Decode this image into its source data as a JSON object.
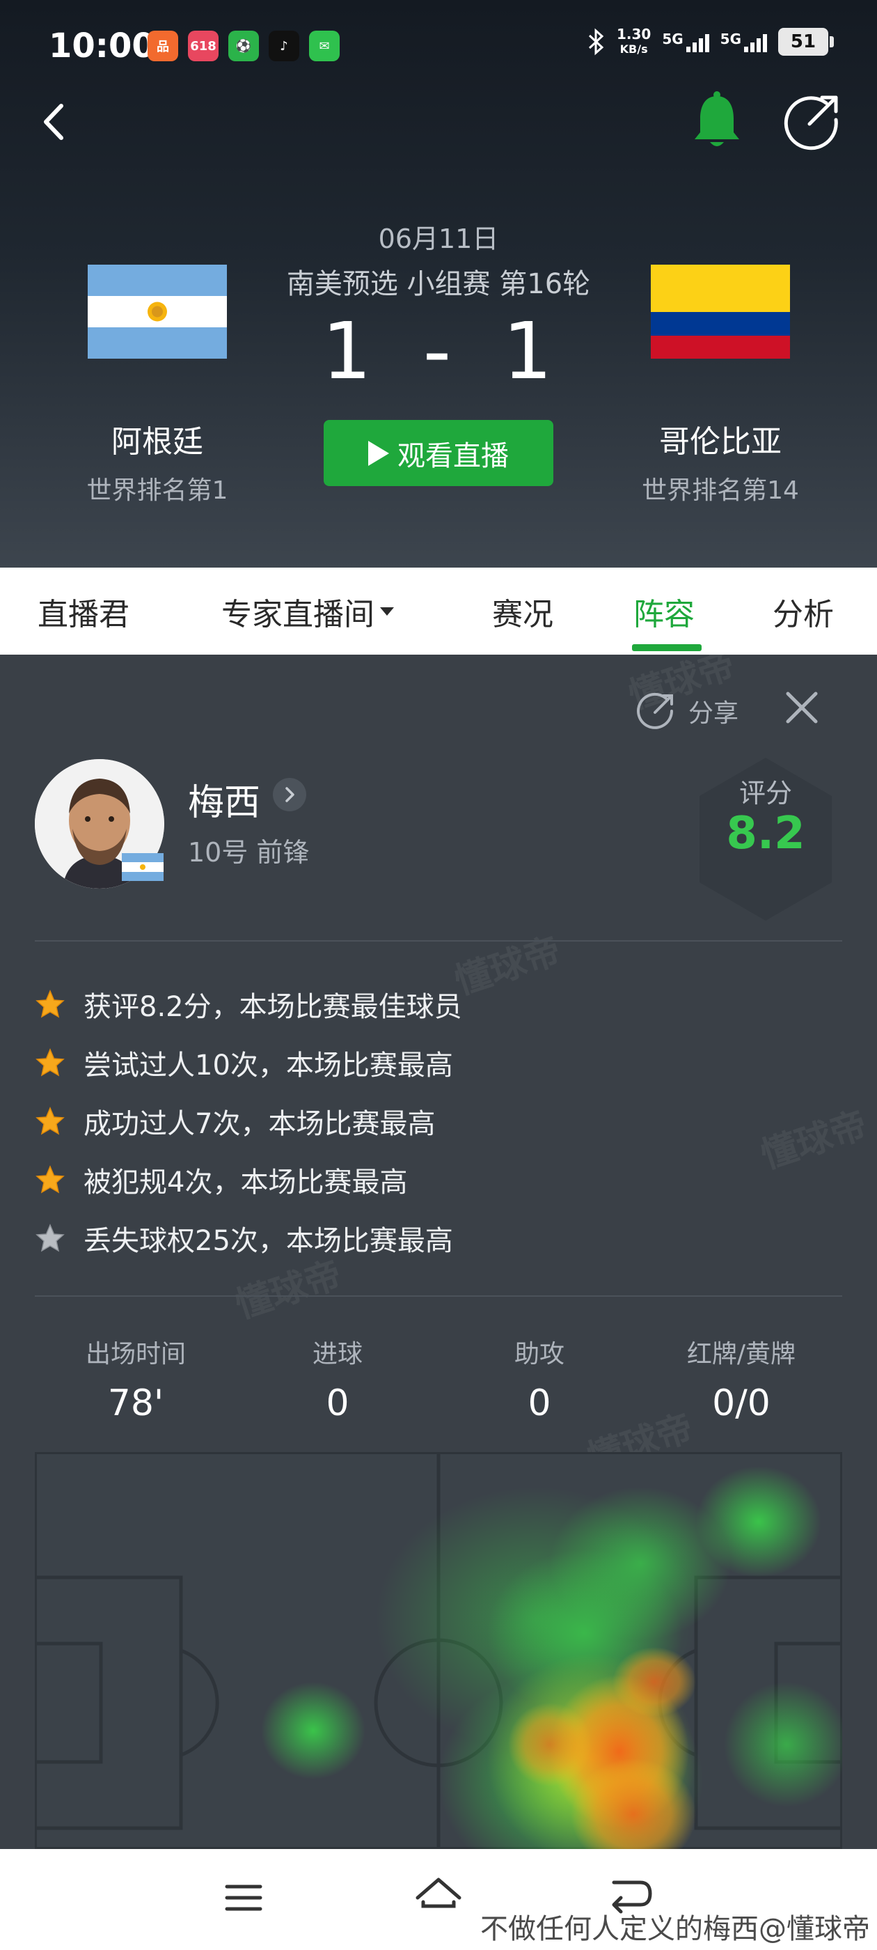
{
  "status_bar": {
    "time": "10:00",
    "net_speed_value": "1.30",
    "net_speed_unit": "KB/s",
    "sim1": "5G",
    "sim2": "5G",
    "battery": "51",
    "apps": [
      {
        "name": "shopping-app-icon",
        "color": "#f26a2e",
        "glyph": "品"
      },
      {
        "name": "618-app-icon",
        "color": "#e8475f",
        "glyph": "618"
      },
      {
        "name": "green-app-icon",
        "color": "#2bb34a",
        "glyph": "⚽"
      },
      {
        "name": "tiktok-icon",
        "color": "#111111",
        "glyph": "♪"
      },
      {
        "name": "wechat-icon",
        "color": "#2fc14e",
        "glyph": "✉"
      }
    ]
  },
  "match": {
    "date": "06月11日",
    "competition": "南美预选 小组赛 第16轮",
    "home_score": "1",
    "separator": "-",
    "away_score": "1",
    "home": {
      "name": "阿根廷",
      "rank": "世界排名第1"
    },
    "away": {
      "name": "哥伦比亚",
      "rank": "世界排名第14"
    },
    "watch_label": "观看直播"
  },
  "tabs": [
    {
      "label": "直播君"
    },
    {
      "label": "专家直播间"
    },
    {
      "label": "赛况"
    },
    {
      "label": "阵容"
    },
    {
      "label": "分析"
    }
  ],
  "active_tab": "阵容",
  "share_label": "分享",
  "player": {
    "name": "梅西",
    "info": "10号 前锋",
    "rating_label": "评分",
    "rating": "8.2"
  },
  "achievements": [
    {
      "text": "获评8.2分，本场比赛最佳球员",
      "star": "gold"
    },
    {
      "text": "尝试过人10次，本场比赛最高",
      "star": "gold"
    },
    {
      "text": "成功过人7次，本场比赛最高",
      "star": "gold"
    },
    {
      "text": "被犯规4次，本场比赛最高",
      "star": "gold"
    },
    {
      "text": "丢失球权25次，本场比赛最高",
      "star": "silver"
    }
  ],
  "stats": [
    {
      "label": "出场时间",
      "value": "78'"
    },
    {
      "label": "进球",
      "value": "0"
    },
    {
      "label": "助攻",
      "value": "0"
    },
    {
      "label": "红牌/黄牌",
      "value": "0/0"
    }
  ],
  "watermark": "懂球帝",
  "caption": "不做任何人定义的梅西@懂球帝",
  "colors": {
    "accent_green": "#1fa83c",
    "rating_green": "#37c84f",
    "content_bg": "#3a4047"
  }
}
